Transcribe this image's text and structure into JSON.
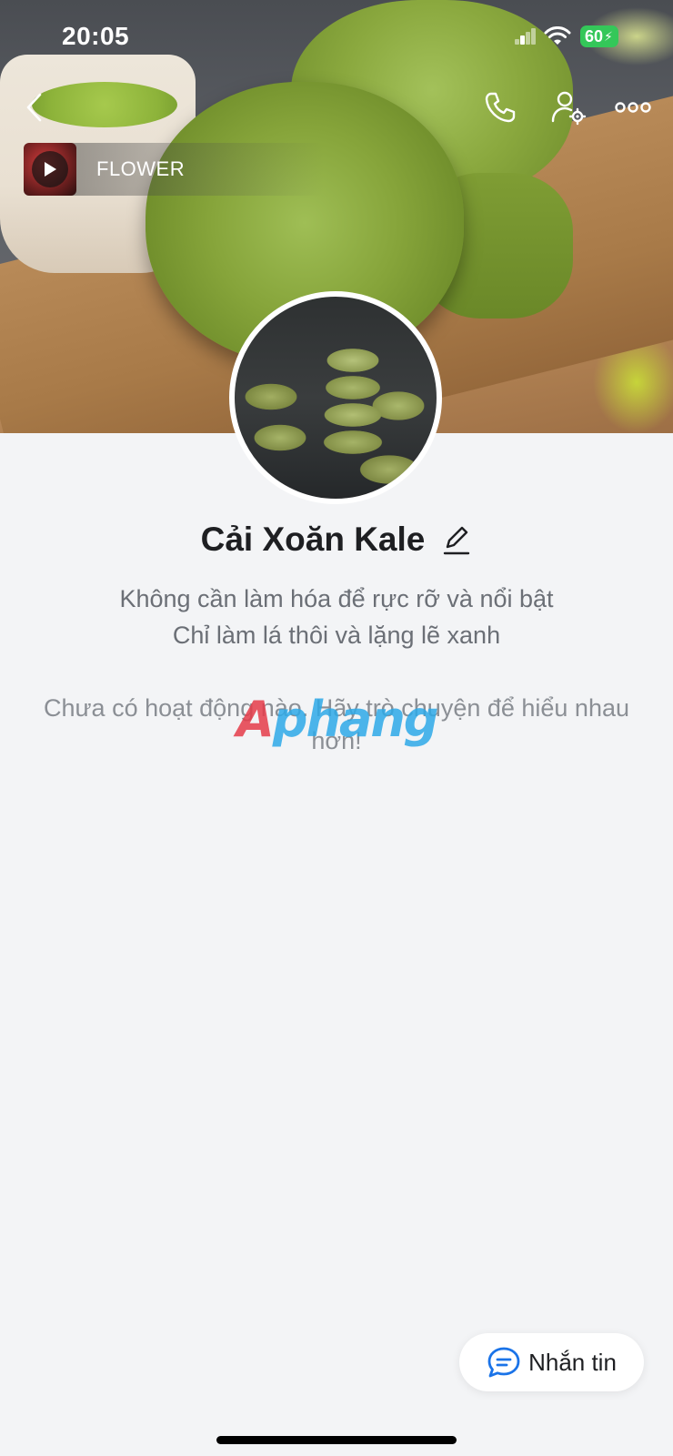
{
  "status_bar": {
    "time": "20:05",
    "battery": "60"
  },
  "header": {
    "back_icon": "chevron-left-icon",
    "call_icon": "phone-icon",
    "settings_icon": "user-settings-icon",
    "more_icon": "more-dots-icon"
  },
  "music": {
    "song_title": "FLOWER"
  },
  "profile": {
    "name": "Cải Xoăn Kale",
    "bio_line1": "Không cần làm hóa để rực rỡ và nổi bật",
    "bio_line2": "Chỉ làm lá thôi và lặng lẽ xanh"
  },
  "feed": {
    "empty_text": "Chưa có hoạt động nào. Hãy trò chuyện để hiểu nhau hơn!"
  },
  "watermark": {
    "first": "A",
    "rest": "phang"
  },
  "actions": {
    "message_label": "Nhắn tin"
  },
  "colors": {
    "battery": "#34c759",
    "message_icon": "#1a73e8",
    "text_primary": "#1e1f22",
    "text_secondary": "#6b6f76"
  }
}
